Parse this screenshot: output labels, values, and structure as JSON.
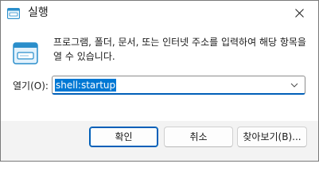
{
  "window": {
    "title": "실행",
    "title_icon": "run-dialog-icon",
    "close_icon": "close-icon"
  },
  "content": {
    "icon": "run-dialog-icon",
    "description": "프로그램, 폴더, 문서, 또는 인터넷 주소를 입력하여 해당 항목을 열 수 있습니다."
  },
  "open_field": {
    "label": "열기(O):",
    "value": "shell:startup",
    "dropdown_icon": "chevron-down-icon"
  },
  "buttons": {
    "ok": "확인",
    "cancel": "취소",
    "browse": "찾아보기(B)..."
  },
  "colors": {
    "accent": "#0078d4",
    "focus_border": "#005fb8",
    "footer_bg": "#f3f3f3"
  }
}
